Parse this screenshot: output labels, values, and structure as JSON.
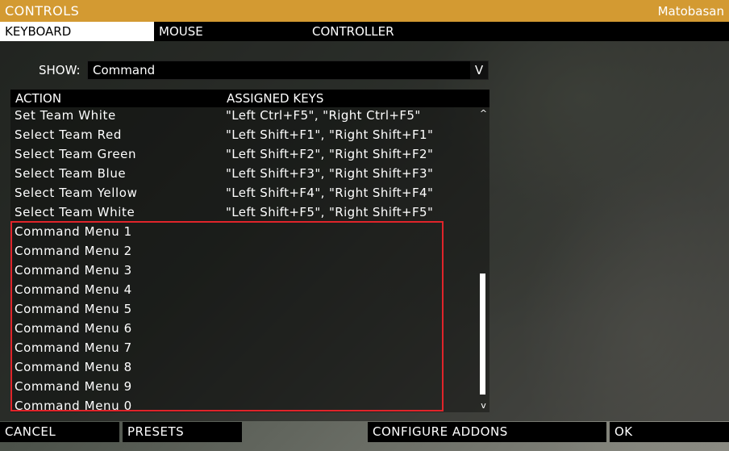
{
  "window": {
    "title": "CONTROLS",
    "user": "Matobasan",
    "accent_color": "#d39a32"
  },
  "tabs": [
    {
      "label": "KEYBOARD",
      "active": true
    },
    {
      "label": "MOUSE",
      "active": false
    },
    {
      "label": "CONTROLLER",
      "active": false
    }
  ],
  "filter": {
    "label": "SHOW:",
    "value": "Command",
    "dropdown_glyph": "V"
  },
  "list": {
    "headers": {
      "action": "ACTION",
      "keys": "ASSIGNED KEYS"
    },
    "rows": [
      {
        "action": "Set Team White",
        "keys": "\"Left Ctrl+F5\", \"Right Ctrl+F5\""
      },
      {
        "action": "Select Team Red",
        "keys": "\"Left Shift+F1\", \"Right Shift+F1\""
      },
      {
        "action": "Select Team Green",
        "keys": "\"Left Shift+F2\", \"Right Shift+F2\""
      },
      {
        "action": "Select Team Blue",
        "keys": "\"Left Shift+F3\", \"Right Shift+F3\""
      },
      {
        "action": "Select Team Yellow",
        "keys": "\"Left Shift+F4\", \"Right Shift+F4\""
      },
      {
        "action": "Select Team White",
        "keys": "\"Left Shift+F5\", \"Right Shift+F5\""
      },
      {
        "action": "Command Menu 1",
        "keys": ""
      },
      {
        "action": "Command Menu 2",
        "keys": ""
      },
      {
        "action": "Command Menu 3",
        "keys": ""
      },
      {
        "action": "Command Menu 4",
        "keys": ""
      },
      {
        "action": "Command Menu 5",
        "keys": ""
      },
      {
        "action": "Command Menu 6",
        "keys": ""
      },
      {
        "action": "Command Menu 7",
        "keys": ""
      },
      {
        "action": "Command Menu 8",
        "keys": ""
      },
      {
        "action": "Command Menu 9",
        "keys": ""
      },
      {
        "action": "Command Menu 0",
        "keys": ""
      }
    ],
    "scroll_up_glyph": "^",
    "scroll_down_glyph": "v",
    "highlight_color": "#e0242a"
  },
  "footer": {
    "cancel": "CANCEL",
    "presets": "PRESETS",
    "configure_addons": "CONFIGURE ADDONS",
    "ok": "OK"
  }
}
